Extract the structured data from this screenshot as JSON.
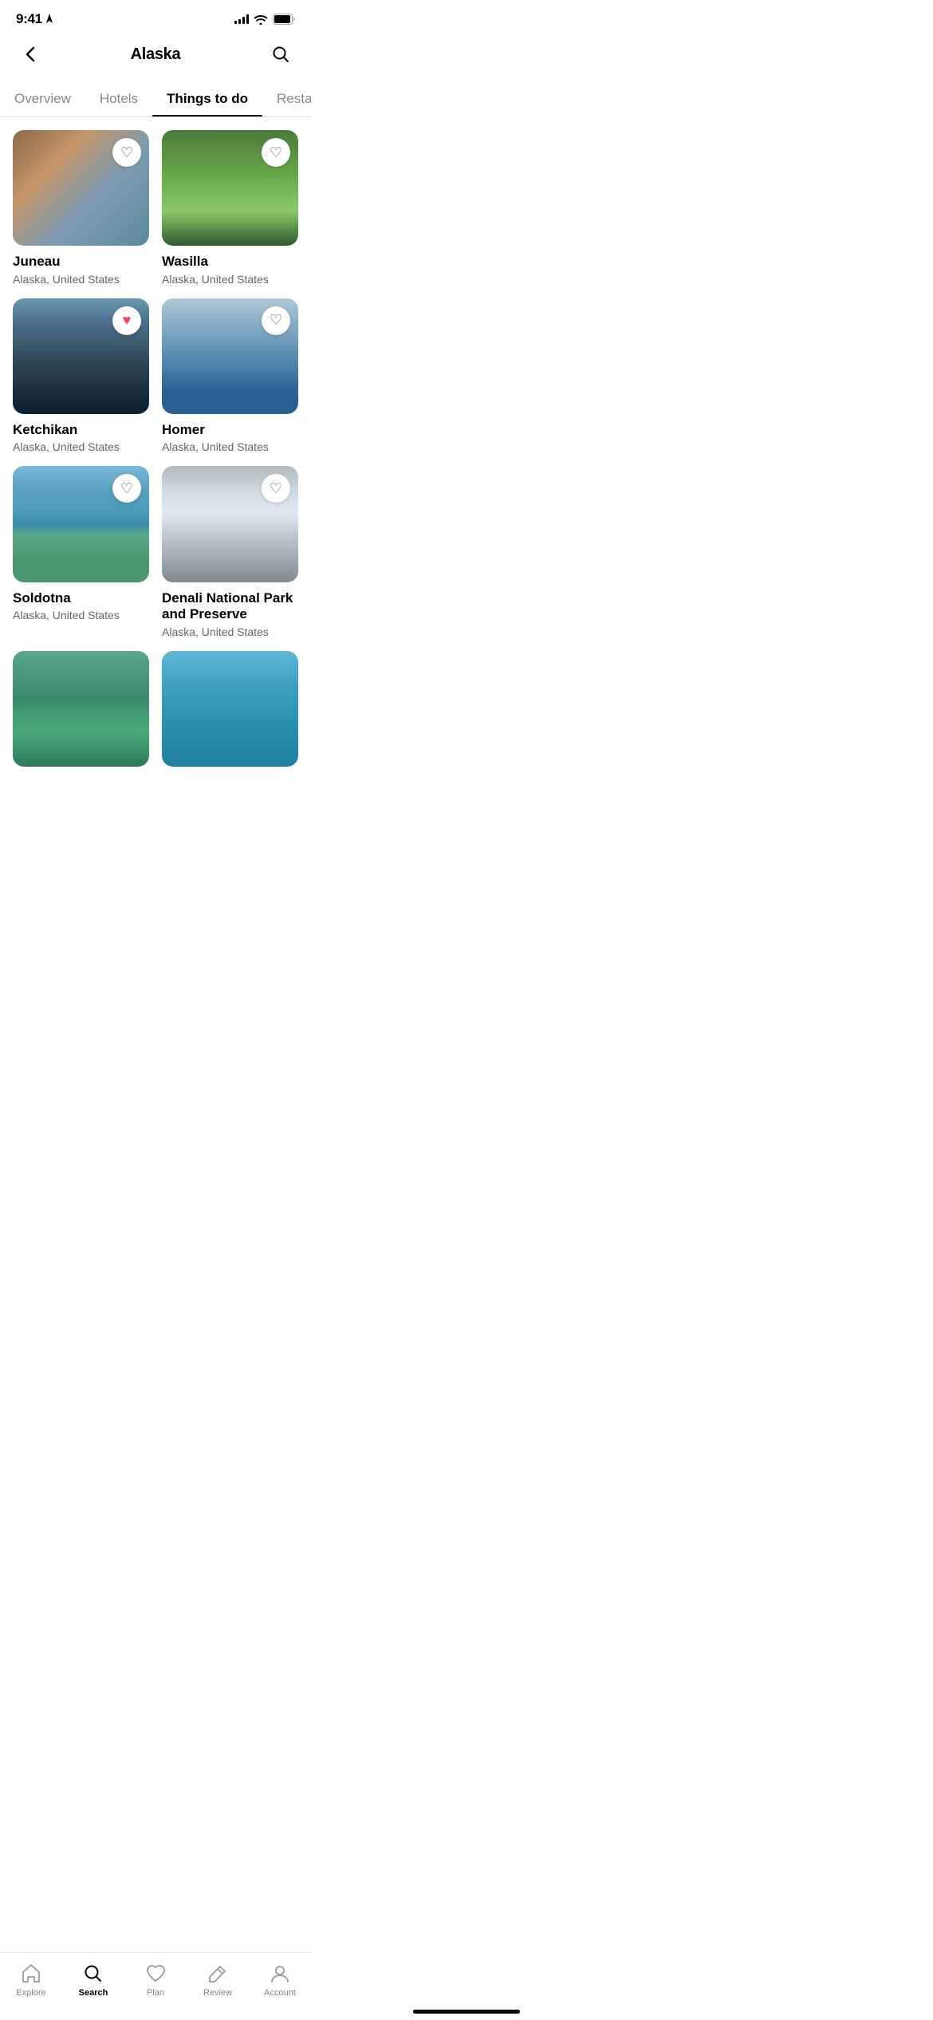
{
  "statusBar": {
    "time": "9:41",
    "locationArrow": true
  },
  "header": {
    "title": "Alaska",
    "backLabel": "back",
    "searchLabel": "search"
  },
  "tabs": [
    {
      "id": "overview",
      "label": "Overview",
      "active": false
    },
    {
      "id": "hotels",
      "label": "Hotels",
      "active": false
    },
    {
      "id": "things-to-do",
      "label": "Things to do",
      "active": true
    },
    {
      "id": "restaurants",
      "label": "Restaurants",
      "active": false
    }
  ],
  "cards": [
    {
      "id": "juneau",
      "name": "Juneau",
      "subtitle": "Alaska, United States",
      "liked": false,
      "imgClass": "img-juneau"
    },
    {
      "id": "wasilla",
      "name": "Wasilla",
      "subtitle": "Alaska, United States",
      "liked": false,
      "imgClass": "img-wasilla"
    },
    {
      "id": "ketchikan",
      "name": "Ketchikan",
      "subtitle": "Alaska, United States",
      "liked": true,
      "imgClass": "img-ketchikan"
    },
    {
      "id": "homer",
      "name": "Homer",
      "subtitle": "Alaska, United States",
      "liked": false,
      "imgClass": "img-homer"
    },
    {
      "id": "soldotna",
      "name": "Soldotna",
      "subtitle": "Alaska, United States",
      "liked": false,
      "imgClass": "img-soldotna"
    },
    {
      "id": "denali",
      "name": "Denali National Park and Preserve",
      "subtitle": "Alaska, United States",
      "liked": false,
      "imgClass": "img-denali"
    }
  ],
  "bottomNav": [
    {
      "id": "explore",
      "label": "Explore",
      "active": false,
      "icon": "home"
    },
    {
      "id": "search",
      "label": "Search",
      "active": true,
      "icon": "search"
    },
    {
      "id": "plan",
      "label": "Plan",
      "active": false,
      "icon": "heart"
    },
    {
      "id": "review",
      "label": "Review",
      "active": false,
      "icon": "pencil"
    },
    {
      "id": "account",
      "label": "Account",
      "active": false,
      "icon": "person"
    }
  ]
}
